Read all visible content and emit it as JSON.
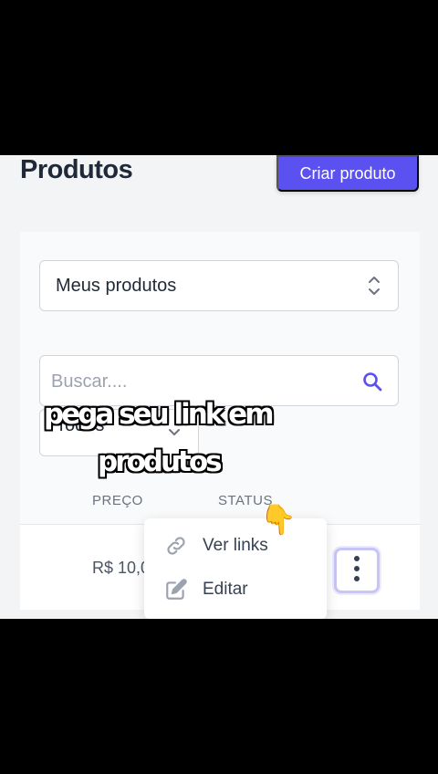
{
  "header": {
    "title": "Produtos",
    "create_button": "Criar produto"
  },
  "filters": {
    "product_scope": "Meus produtos",
    "search_placeholder": "Buscar....",
    "status_filter": "Todos"
  },
  "table": {
    "columns": [
      "PREÇO",
      "STATUS"
    ],
    "rows": [
      {
        "price": "R$ 10,0"
      }
    ]
  },
  "row_menu": {
    "items": [
      {
        "label": "Ver links",
        "icon": "link-icon"
      },
      {
        "label": "Editar",
        "icon": "edit-icon"
      }
    ]
  },
  "overlay": {
    "caption_line1": "pega seu link em",
    "caption_line2": "produtos",
    "pointer_emoji": "👇"
  },
  "colors": {
    "accent": "#5b50f0",
    "background": "#f3f4f6"
  }
}
